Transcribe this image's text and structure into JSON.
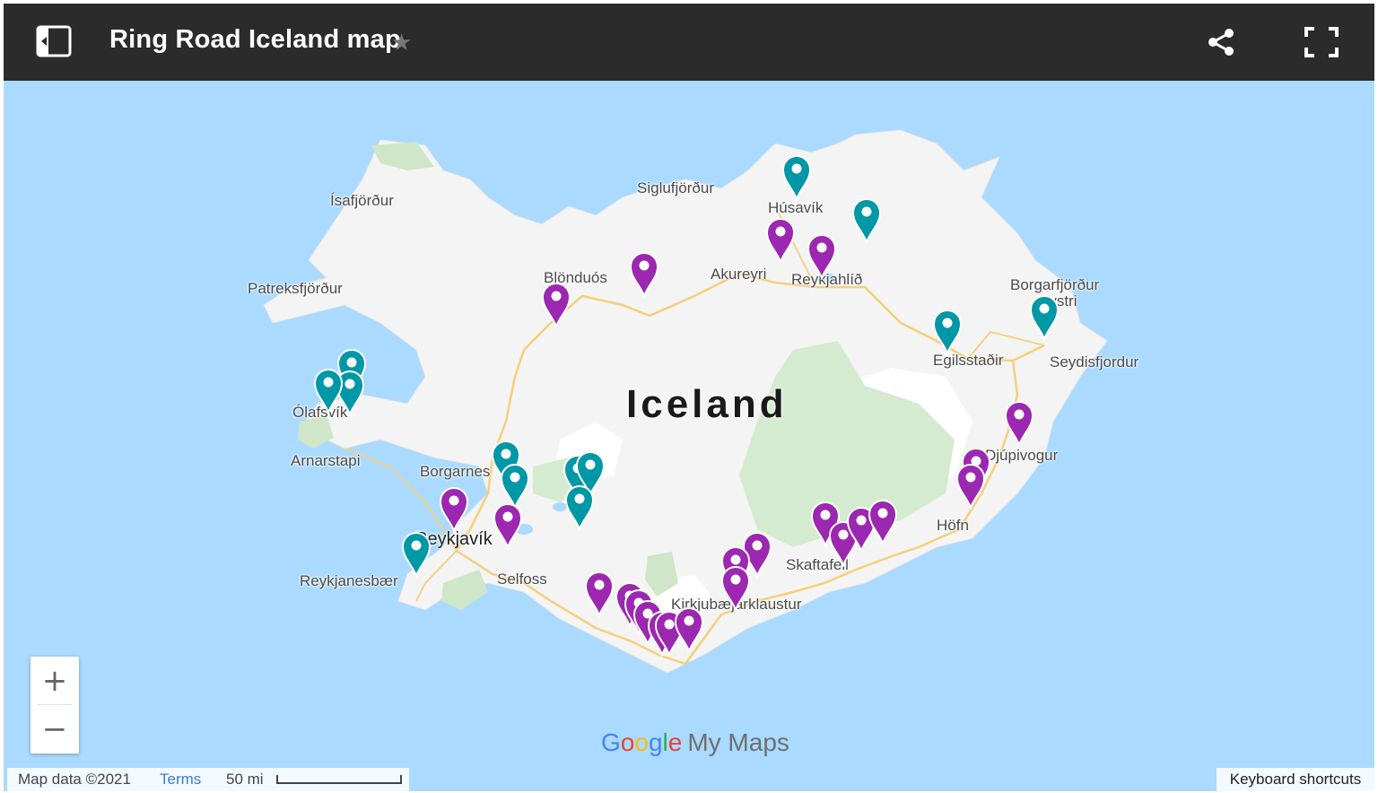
{
  "header": {
    "title": "Ring Road Iceland map",
    "star_glyph": "★",
    "icons": [
      "sidebar-toggle-icon",
      "star-icon",
      "share-icon",
      "fullscreen-icon"
    ]
  },
  "map": {
    "country_label": "Iceland",
    "places": {
      "isafjordur": "Ísafjörður",
      "patreksfjordur": "Patreksfjörður",
      "siglufjordur": "Siglufjörður",
      "husavik": "Húsavík",
      "blonduos": "Blönduós",
      "akureyri": "Akureyri",
      "reykjahlid": "Reykjahlíð",
      "borgarfjordur": "Borgarfjörður",
      "eystri": "Eystri",
      "egilsstadir": "Egilsstaðir",
      "seydisfjordur": "Seydisfjordur",
      "olafsvik": "Ólafsvík",
      "arnarstapi": "Arnarstapi",
      "djupivogur": "Djúpivogur",
      "borgarnes": "Borgarnes",
      "hofn": "Höfn",
      "reykjavik": "Reykjavík",
      "selfoss": "Selfoss",
      "reykjanesbaer": "Reykjanesbær",
      "skaftafell": "Skaftafell",
      "kirkjubaejarklaustur": "Kirkjubæjarklaustur"
    },
    "colors": {
      "water": "#aadaff",
      "land": "#f4f4f4",
      "glacier": "#ffffff",
      "park": "#d4ebd0",
      "road": "#f5cf7a",
      "pin_purple": "#9c27b0",
      "pin_teal": "#0097a7"
    }
  },
  "controls": {
    "zoom_in": "+",
    "zoom_out": "−"
  },
  "branding": {
    "google_letters": [
      "G",
      "o",
      "o",
      "g",
      "l",
      "e"
    ],
    "my_maps": "My Maps"
  },
  "footer": {
    "map_data": "Map data ©2021",
    "terms": "Terms",
    "scale": "50 mi",
    "keyboard_shortcuts": "Keyboard shortcuts"
  }
}
